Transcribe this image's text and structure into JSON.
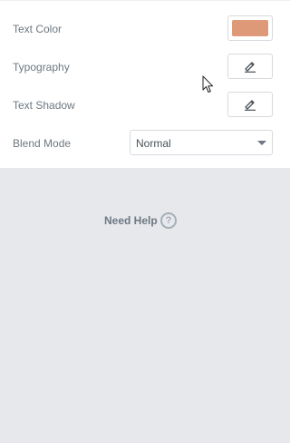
{
  "controls": {
    "text_color": {
      "label": "Text Color",
      "value_color": "#de9a78"
    },
    "typography": {
      "label": "Typography",
      "edit_icon": "pencil-icon"
    },
    "text_shadow": {
      "label": "Text Shadow",
      "edit_icon": "pencil-icon"
    },
    "blend_mode": {
      "label": "Blend Mode",
      "selected": "Normal"
    }
  },
  "help": {
    "label": "Need Help",
    "icon": "question-circle-icon"
  },
  "colors": {
    "panel_background": "#ffffff",
    "page_background": "#e6e8ec",
    "label_text": "#6d7882",
    "border": "#d5dadf"
  }
}
